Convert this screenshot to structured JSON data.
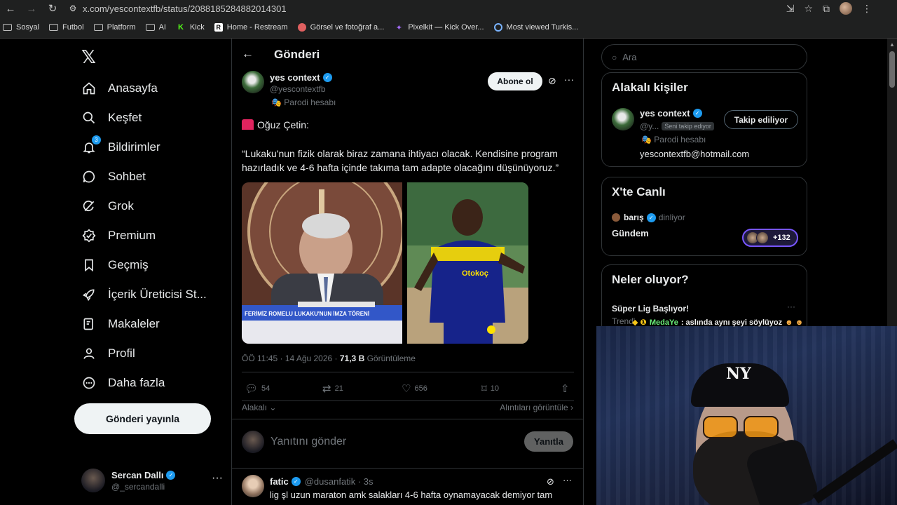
{
  "browser": {
    "url": "x.com/yescontextfb/status/2088185284882014301",
    "bookmarks": [
      {
        "label": "Sosyal",
        "icon": "folder-icon"
      },
      {
        "label": "Futbol",
        "icon": "folder-icon"
      },
      {
        "label": "Platform",
        "icon": "folder-icon"
      },
      {
        "label": "AI",
        "icon": "folder-icon"
      },
      {
        "label": "Kick",
        "icon": "kick-icon"
      },
      {
        "label": "Home - Restream",
        "icon": "restream-icon"
      },
      {
        "label": "Görsel ve fotoğraf a...",
        "icon": "image-icon"
      },
      {
        "label": "Pixelkit — Kick Over...",
        "icon": "pixelkit-icon"
      },
      {
        "label": "Most viewed Turkis...",
        "icon": "globe-icon"
      }
    ]
  },
  "sidebar": {
    "logo": "𝕏",
    "items": [
      {
        "label": "Anasayfa",
        "icon": "home-icon"
      },
      {
        "label": "Keşfet",
        "icon": "search-icon"
      },
      {
        "label": "Bildirimler",
        "icon": "bell-icon",
        "badge": "3"
      },
      {
        "label": "Sohbet",
        "icon": "chat-icon"
      },
      {
        "label": "Grok",
        "icon": "grok-icon"
      },
      {
        "label": "Premium",
        "icon": "premium-icon"
      },
      {
        "label": "Geçmiş",
        "icon": "bookmark-icon"
      },
      {
        "label": "İçerik Üreticisi St...",
        "icon": "rocket-icon"
      },
      {
        "label": "Makaleler",
        "icon": "article-icon"
      },
      {
        "label": "Profil",
        "icon": "person-icon"
      },
      {
        "label": "Daha fazla",
        "icon": "more-circle-icon"
      }
    ],
    "post_button": "Gönderi yayınla",
    "account": {
      "name": "Sercan Dallı",
      "handle": "@_sercandalli"
    }
  },
  "header": {
    "title": "Gönderi"
  },
  "tweet": {
    "author_name": "yes context",
    "author_handle": "@yescontextfb",
    "parody_label": "Parodi hesabı",
    "subscribe_label": "Abone ol",
    "line1": "Oğuz Çetin:",
    "body": "“Lukaku'nun fizik olarak biraz zamana ihtiyacı olacak. Kendisine program hazırladık ve 4-6 hafta içinde takıma tam adapte olacağını düşünüyoruz.”",
    "media_caption": "FERİMİZ ROMELU LUKAKU'NUN İMZA TÖRENİ",
    "jersey_text": "Otokoç",
    "time": "ÖÖ 11:45 · 14 Ağu 2026 · ",
    "views": "71,3 B",
    "views_label": " Görüntüleme",
    "stats": {
      "replies": "54",
      "reposts": "21",
      "likes": "656",
      "bookmarks": "10"
    },
    "relevant_label": "Alakalı",
    "quotes_label": "Alıntıları görüntüle"
  },
  "reply_box": {
    "placeholder": "Yanıtını gönder",
    "button": "Yanıtla"
  },
  "reply": {
    "name": "fatic",
    "handle": "@dusanfatik · 3s",
    "text": "lig şl uzun maraton amk salakları 4-6 hafta oynamayacak demiyor tam"
  },
  "right": {
    "search_placeholder": "Ara",
    "related": {
      "title": "Alakalı kişiler",
      "name": "yes context",
      "handle": "@y...",
      "follows_you": "Seni takip ediyor",
      "parody": "Parodi hesabı",
      "email": "yescontextfb@hotmail.com",
      "follow_label": "Takip ediliyor"
    },
    "live": {
      "title": "X'te Canlı",
      "user": "barış",
      "status": "dinliyor",
      "topic": "Gündem",
      "count": "+132"
    },
    "trends": {
      "title": "Neler oluyor?",
      "item": "Süper Lig Başlıyor!",
      "sub": "Trend'"
    }
  },
  "stream": {
    "chat_user": "MedaYe",
    "chat_text": ": aslında aynı şeyi söylüyoz",
    "cap_logo": "NY"
  },
  "colors": {
    "accent": "#1d9bf0",
    "background": "#000000",
    "border": "#2f3336",
    "muted": "#71767b"
  }
}
